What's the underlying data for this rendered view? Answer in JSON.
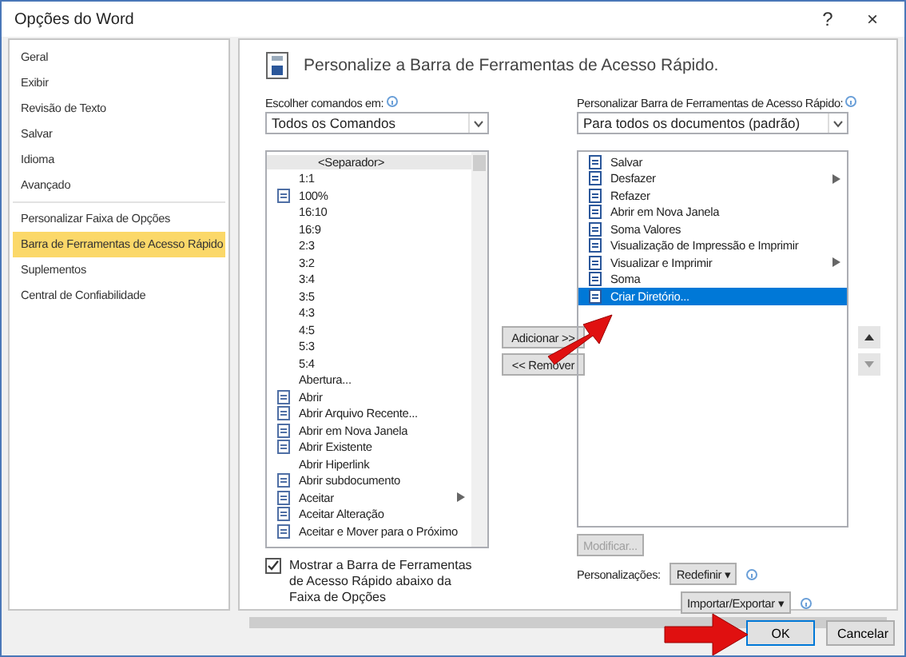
{
  "window": {
    "title": "Opções do Word",
    "help": "?",
    "close": "×"
  },
  "sidebar": {
    "groups": [
      [
        {
          "label": "Geral",
          "selected": false
        },
        {
          "label": "Exibir",
          "selected": false
        },
        {
          "label": "Revisão de Texto",
          "selected": false
        },
        {
          "label": "Salvar",
          "selected": false
        },
        {
          "label": "Idioma",
          "selected": false
        },
        {
          "label": "Avançado",
          "selected": false
        }
      ],
      [
        {
          "label": "Personalizar Faixa de Opções",
          "selected": false
        },
        {
          "label": "Barra de Ferramentas de Acesso Rápido",
          "selected": true
        },
        {
          "label": "Suplementos",
          "selected": false
        },
        {
          "label": "Central de Confiabilidade",
          "selected": false
        }
      ]
    ]
  },
  "header": {
    "title": "Personalize a Barra de Ferramentas de Acesso Rápido."
  },
  "commands": {
    "label": "Escolher comandos em:",
    "value": "Todos os Comandos",
    "items": [
      {
        "label": "<Separador>",
        "kind": "separator",
        "submenu": false
      },
      {
        "label": "1:1",
        "kind": "plain",
        "submenu": false
      },
      {
        "label": "100%",
        "kind": "icon",
        "submenu": false
      },
      {
        "label": "16:10",
        "kind": "plain",
        "submenu": false
      },
      {
        "label": "16:9",
        "kind": "plain",
        "submenu": false
      },
      {
        "label": "2:3",
        "kind": "plain",
        "submenu": false
      },
      {
        "label": "3:2",
        "kind": "plain",
        "submenu": false
      },
      {
        "label": "3:4",
        "kind": "plain",
        "submenu": false
      },
      {
        "label": "3:5",
        "kind": "plain",
        "submenu": false
      },
      {
        "label": "4:3",
        "kind": "plain",
        "submenu": false
      },
      {
        "label": "4:5",
        "kind": "plain",
        "submenu": false
      },
      {
        "label": "5:3",
        "kind": "plain",
        "submenu": false
      },
      {
        "label": "5:4",
        "kind": "plain",
        "submenu": false
      },
      {
        "label": "Abertura...",
        "kind": "plain",
        "submenu": false
      },
      {
        "label": "Abrir",
        "kind": "icon",
        "submenu": false
      },
      {
        "label": "Abrir Arquivo Recente...",
        "kind": "icon",
        "submenu": false
      },
      {
        "label": "Abrir em Nova Janela",
        "kind": "icon",
        "submenu": false
      },
      {
        "label": "Abrir Existente",
        "kind": "icon",
        "submenu": false
      },
      {
        "label": "Abrir Hiperlink",
        "kind": "plain",
        "submenu": false
      },
      {
        "label": "Abrir subdocumento",
        "kind": "icon",
        "submenu": false
      },
      {
        "label": "Aceitar",
        "kind": "icon",
        "submenu": true
      },
      {
        "label": "Aceitar Alteração",
        "kind": "icon",
        "submenu": false
      },
      {
        "label": "Aceitar e Mover para o Próximo",
        "kind": "icon",
        "submenu": false
      }
    ],
    "show_below": {
      "label": "Mostrar a Barra de Ferramentas de Acesso Rápido abaixo da Faixa de Opções",
      "checked": true
    }
  },
  "add_button": "Adicionar >>",
  "remove_button": "<< Remover",
  "toolbar": {
    "label": "Personalizar Barra de Ferramentas de Acesso Rápido:",
    "value": "Para todos os documentos (padrão)",
    "items": [
      {
        "label": "Salvar",
        "selected": false,
        "submenu": false
      },
      {
        "label": "Desfazer",
        "selected": false,
        "submenu": true
      },
      {
        "label": "Refazer",
        "selected": false,
        "submenu": false
      },
      {
        "label": "Abrir em Nova Janela",
        "selected": false,
        "submenu": false
      },
      {
        "label": "Soma Valores",
        "selected": false,
        "submenu": false
      },
      {
        "label": "Visualização de Impressão e Imprimir",
        "selected": false,
        "submenu": false
      },
      {
        "label": "Visualizar e Imprimir",
        "selected": false,
        "submenu": true
      },
      {
        "label": "Soma",
        "selected": false,
        "submenu": false
      },
      {
        "label": "Criar Diretório...",
        "selected": true,
        "submenu": false
      }
    ],
    "modify_button": {
      "label": "Modificar...",
      "disabled": true
    },
    "customizations_label": "Personalizações:",
    "reset_button": "Redefinir ▾",
    "import_export_button": "Importar/Exportar ▾"
  },
  "footer": {
    "ok": "OK",
    "cancel": "Cancelar"
  }
}
